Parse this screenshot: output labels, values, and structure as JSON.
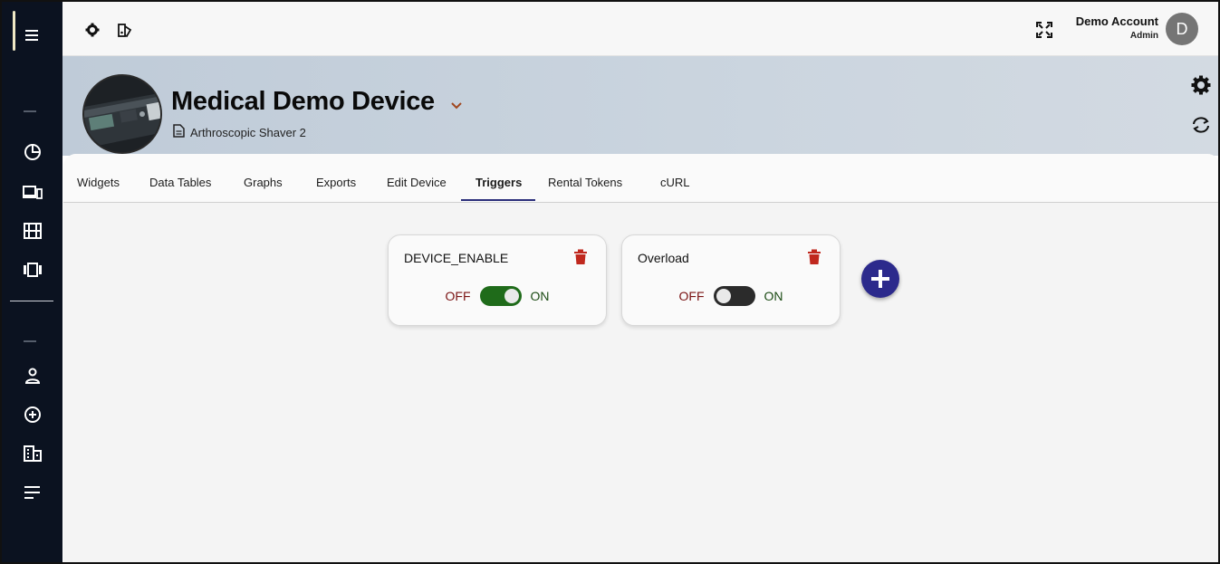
{
  "topbar": {
    "account_name": "Demo Account",
    "account_role": "Admin",
    "avatar_letter": "D"
  },
  "device": {
    "name": "Medical Demo Device",
    "model": "Arthroscopic Shaver 2"
  },
  "tabs": [
    {
      "label": "Widgets"
    },
    {
      "label": "Data Tables"
    },
    {
      "label": "Graphs"
    },
    {
      "label": "Exports"
    },
    {
      "label": "Edit Device"
    },
    {
      "label": "Triggers",
      "active": true
    },
    {
      "label": "Rental Tokens"
    },
    {
      "label": "cURL"
    }
  ],
  "triggers": [
    {
      "name": "DEVICE_ENABLE",
      "off_label": "OFF",
      "on_label": "ON",
      "state": "on"
    },
    {
      "name": "Overload",
      "off_label": "OFF",
      "on_label": "ON",
      "state": "off"
    }
  ],
  "colors": {
    "sidebar": "#0b1220",
    "accent": "#2c2a8c",
    "toggle_on": "#1f6b1a",
    "delete": "#c0281e"
  },
  "icons": {
    "sidebar": [
      "menu-icon",
      "pie-chart-icon",
      "devices-icon",
      "film-icon",
      "carousel-icon",
      "person-icon",
      "add-circle-icon",
      "building-icon",
      "sort-lines-icon"
    ],
    "topbar": [
      "gear-icon",
      "palette-swap-icon",
      "fullscreen-icon"
    ],
    "header": [
      "gear-icon",
      "sync-icon"
    ]
  }
}
